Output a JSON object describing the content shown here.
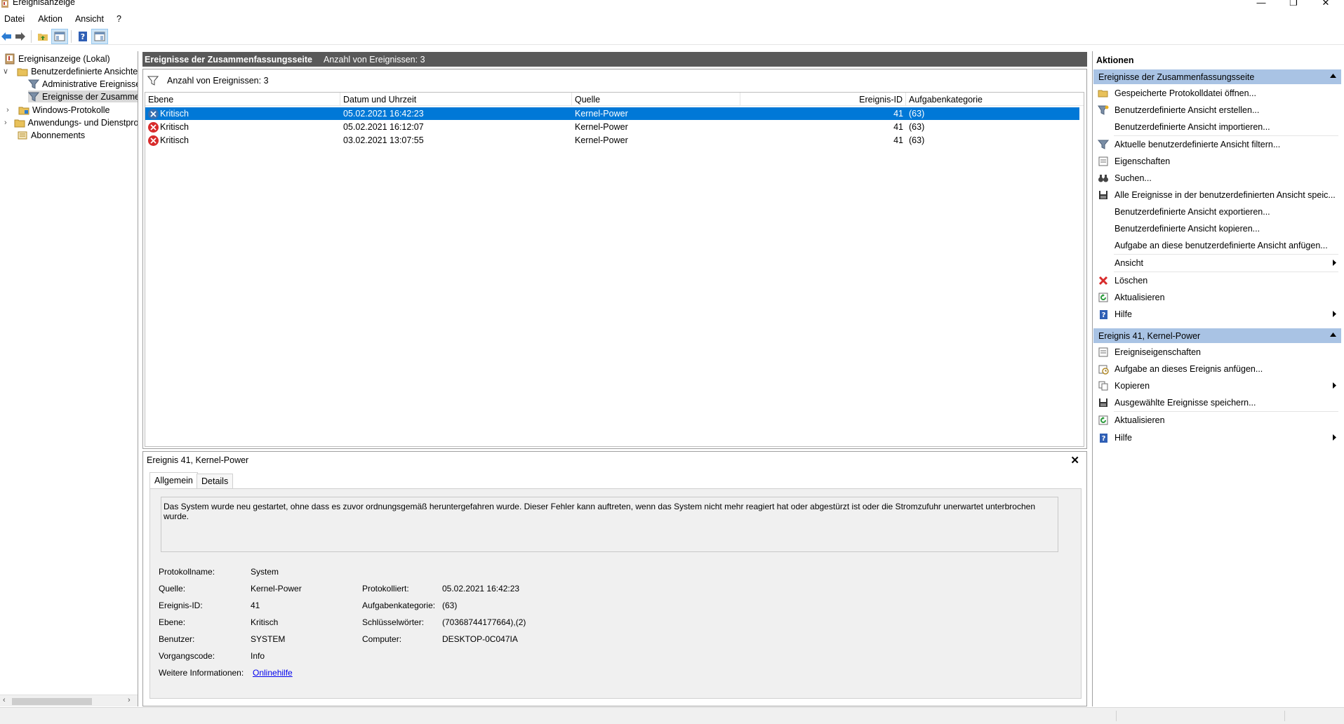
{
  "window": {
    "title": "Ereignisanzeige"
  },
  "menu": [
    "Datei",
    "Aktion",
    "Ansicht",
    "?"
  ],
  "tree": [
    {
      "label": "Ereignisanzeige (Lokal)"
    },
    {
      "label": "Benutzerdefinierte Ansichten"
    },
    {
      "label": "Administrative Ereignisse"
    },
    {
      "label": "Ereignisse der Zusammenfassungsseite"
    },
    {
      "label": "Windows-Protokolle"
    },
    {
      "label": "Anwendungs- und Dienstprotokolle"
    },
    {
      "label": "Abonnements"
    }
  ],
  "center": {
    "title": "Ereignisse der Zusammenfassungsseite",
    "count_label": "Anzahl von Ereignissen: 3",
    "filter_label": "Anzahl von Ereignissen: 3"
  },
  "table": {
    "columns": [
      "Ebene",
      "Datum und Uhrzeit",
      "Quelle",
      "Ereignis-ID",
      "Aufgabenkategorie"
    ],
    "rows": [
      {
        "level": "Kritisch",
        "datetime": "05.02.2021 16:42:23",
        "source": "Kernel-Power",
        "id": "41",
        "category": "(63)"
      },
      {
        "level": "Kritisch",
        "datetime": "05.02.2021 16:12:07",
        "source": "Kernel-Power",
        "id": "41",
        "category": "(63)"
      },
      {
        "level": "Kritisch",
        "datetime": "03.02.2021 13:07:55",
        "source": "Kernel-Power",
        "id": "41",
        "category": "(63)"
      }
    ]
  },
  "detail": {
    "title": "Ereignis 41, Kernel-Power",
    "tabs": [
      "Allgemein",
      "Details"
    ],
    "description": "Das System wurde neu gestartet, ohne dass es zuvor ordnungsgemäß heruntergefahren wurde. Dieser Fehler kann auftreten, wenn das System nicht mehr reagiert hat oder abgestürzt ist oder die Stromzufuhr unerwartet unterbrochen wurde.",
    "fields": {
      "protokollname_label": "Protokollname:",
      "protokollname": "System",
      "quelle_label": "Quelle:",
      "quelle": "Kernel-Power",
      "protokolliert_label": "Protokolliert:",
      "protokolliert": "05.02.2021 16:42:23",
      "ereignis_id_label": "Ereignis-ID:",
      "ereignis_id": "41",
      "aufgabenkategorie_label": "Aufgabenkategorie:",
      "aufgabenkategorie": "(63)",
      "ebene_label": "Ebene:",
      "ebene": "Kritisch",
      "schluesselwoerter_label": "Schlüsselwörter:",
      "schluesselwoerter": "(70368744177664),(2)",
      "benutzer_label": "Benutzer:",
      "benutzer": "SYSTEM",
      "computer_label": "Computer:",
      "computer": "DESKTOP-0C047IA",
      "vorgangscode_label": "Vorgangscode:",
      "vorgangscode": "Info",
      "weitere_label": "Weitere Informationen:",
      "weitere_link": "Onlinehilfe"
    }
  },
  "actions": {
    "header": "Aktionen",
    "section1": {
      "title": "Ereignisse der Zusammenfassungsseite",
      "items": [
        "Gespeicherte Protokolldatei öffnen...",
        "Benutzerdefinierte Ansicht erstellen...",
        "Benutzerdefinierte Ansicht importieren...",
        "Aktuelle benutzerdefinierte Ansicht filtern...",
        "Eigenschaften",
        "Suchen...",
        "Alle Ereignisse in der benutzerdefinierten Ansicht speic...",
        "Benutzerdefinierte Ansicht exportieren...",
        "Benutzerdefinierte Ansicht kopieren...",
        "Aufgabe an diese benutzerdefinierte Ansicht anfügen...",
        "Ansicht",
        "Löschen",
        "Aktualisieren",
        "Hilfe"
      ]
    },
    "section2": {
      "title": "Ereignis 41, Kernel-Power",
      "items": [
        "Ereigniseigenschaften",
        "Aufgabe an dieses Ereignis anfügen...",
        "Kopieren",
        "Ausgewählte Ereignisse speichern...",
        "Aktualisieren",
        "Hilfe"
      ]
    }
  }
}
